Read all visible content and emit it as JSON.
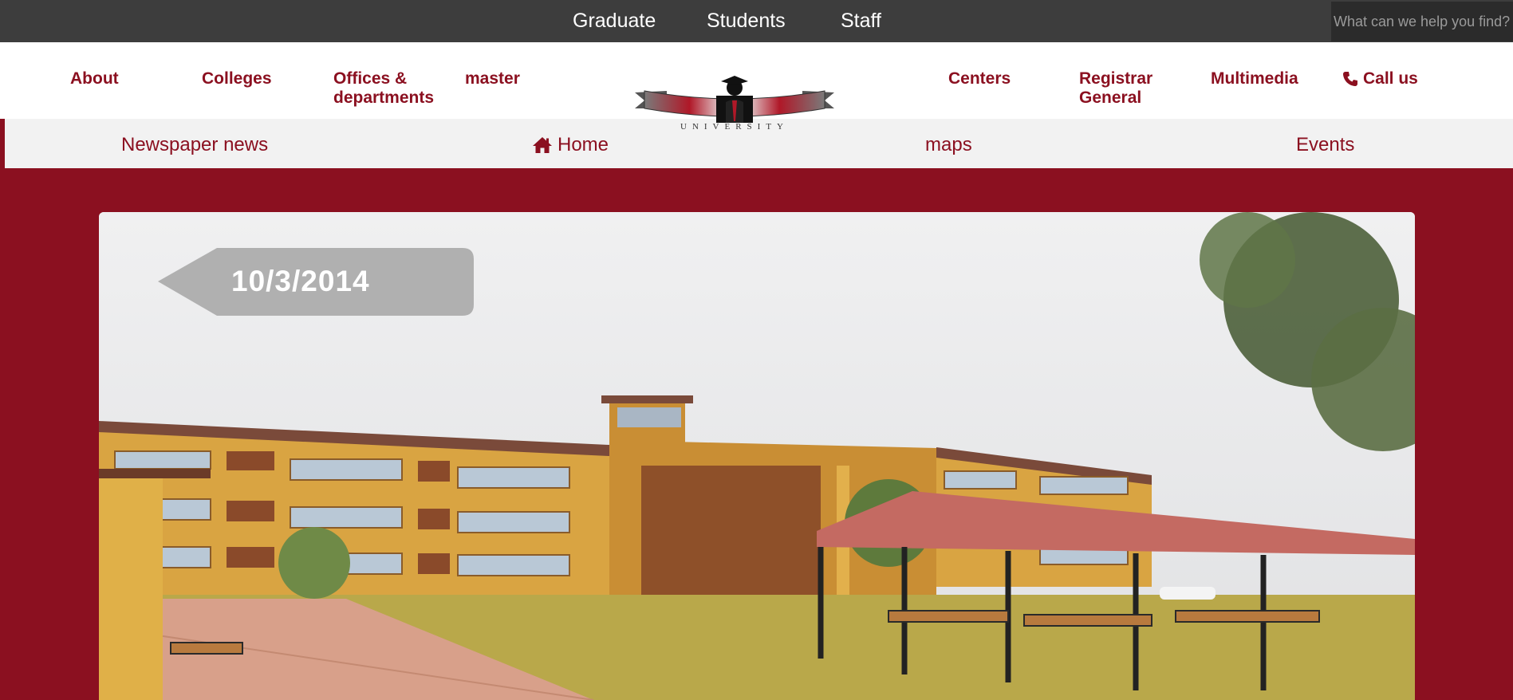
{
  "top_bar": {
    "links": [
      "Graduate",
      "Students",
      "Staff"
    ],
    "search": {
      "placeholder": "What can we help you find?",
      "value": ""
    }
  },
  "main_nav": {
    "left": [
      "About",
      "Colleges",
      "Offices & departments",
      "master"
    ],
    "right": [
      "Centers",
      "Registrar General",
      "Multimedia"
    ],
    "call": {
      "label": "Call us",
      "icon": "phone-icon"
    }
  },
  "logo": {
    "text": "UNIVERSITY"
  },
  "sub_nav": {
    "items": [
      "Newspaper news",
      "Home",
      "maps",
      "Events"
    ],
    "home_icon": "home-icon"
  },
  "hero": {
    "date_label": "10/3/2014"
  },
  "colors": {
    "brand": "#8b1020",
    "topbar": "#3d3d3d",
    "subnav": "#f2f2f2"
  }
}
